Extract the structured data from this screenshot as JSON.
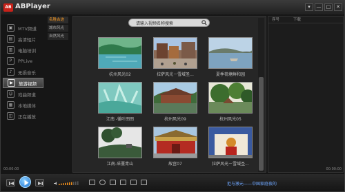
{
  "app": {
    "title": "ABPlayer",
    "logo_text": "AB"
  },
  "window_buttons": [
    "▾",
    "—",
    "□",
    "✕"
  ],
  "nav": {
    "items": [
      {
        "label": "MTV频道",
        "icon": "music-video-icon"
      },
      {
        "label": "高清短片",
        "icon": "hd-clip-icon"
      },
      {
        "label": "电脑培训",
        "icon": "computer-icon"
      },
      {
        "label": "PPLive",
        "icon": "pplive-icon"
      },
      {
        "label": "无损音乐",
        "icon": "music-note-icon"
      },
      {
        "label": "旅游视频",
        "icon": "travel-video-icon",
        "active": true
      },
      {
        "label": "戏曲频道",
        "icon": "opera-icon"
      },
      {
        "label": "本地媒体",
        "icon": "local-media-icon"
      },
      {
        "label": "正在播放",
        "icon": "now-playing-icon"
      }
    ]
  },
  "subcats": [
    {
      "label": "名胜古迹",
      "active": true
    },
    {
      "label": "城市风光"
    },
    {
      "label": "自然风光"
    }
  ],
  "search": {
    "placeholder": "请输入视频名称搜索"
  },
  "videos": [
    {
      "title": "杭州风光02"
    },
    {
      "title": "拉萨风光－雪域圣..."
    },
    {
      "title": "夏季荷塘鲜和园"
    },
    {
      "title": "江南 -循叶田田"
    },
    {
      "title": "杭州风光09"
    },
    {
      "title": "杭州风光05"
    },
    {
      "title": "江南-采薹青山"
    },
    {
      "title": "故宫07"
    },
    {
      "title": "拉萨风光－雪域圣..."
    }
  ],
  "right_panel": {
    "col_1": "序号",
    "col_2": "下载"
  },
  "timeline": {
    "elapsed": "00:00:00",
    "total": "00:00:00"
  },
  "ad_text": "拒与激元——中国家庭夜的",
  "colors": {
    "accent": "#ff9d24",
    "link": "#6fa7ff",
    "logo": "#c8221a"
  }
}
